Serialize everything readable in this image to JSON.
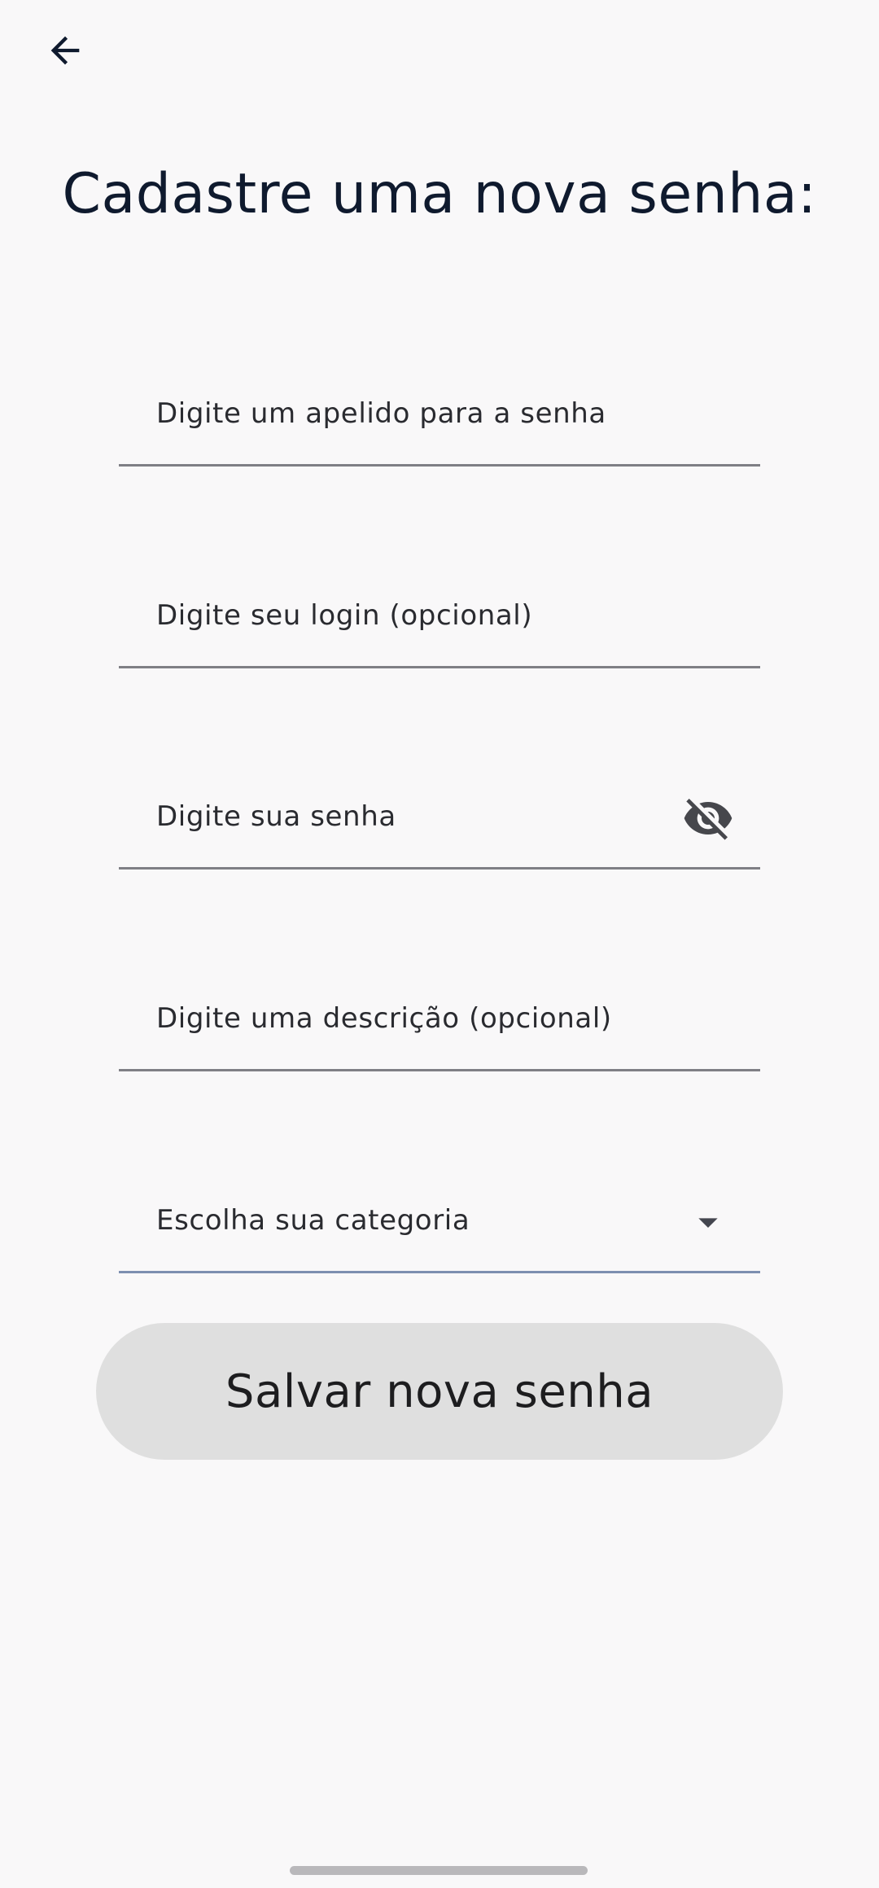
{
  "header": {
    "back_icon": "arrow-left-icon",
    "title": "Cadastre uma nova senha:"
  },
  "form": {
    "nickname_placeholder": "Digite um apelido para a senha",
    "login_placeholder": "Digite seu login (opcional)",
    "password_placeholder": "Digite sua senha",
    "password_toggle_icon": "eye-off-icon",
    "description_placeholder": "Digite uma descrição (opcional)",
    "category_placeholder": "Escolha sua categoria",
    "category_dropdown_icon": "caret-down-icon"
  },
  "actions": {
    "save_label": "Salvar nova senha"
  },
  "colors": {
    "background": "#f9f8f9",
    "title": "#0f1a2e",
    "underline": "#7f7f85",
    "select_underline": "#7d8fb0",
    "button_bg": "#dfdfdf"
  }
}
